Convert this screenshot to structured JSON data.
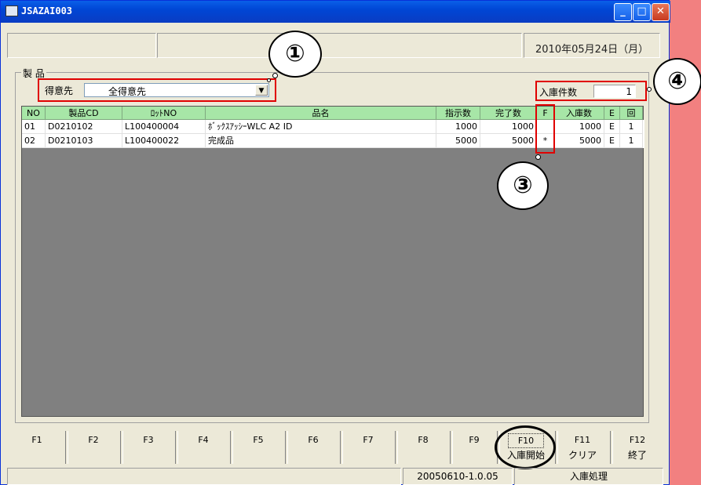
{
  "window": {
    "title": "JSAZAI003"
  },
  "header": {
    "date": "2010年05月24日（月）"
  },
  "group": {
    "title": "製 品",
    "customer_label": "得意先",
    "customer_value": "全得意先",
    "count_label": "入庫件数",
    "count_value": "1"
  },
  "table": {
    "columns": [
      "NO",
      "製品CD",
      "ﾛｯﾄNO",
      "品名",
      "指示数",
      "完了数",
      "F",
      "入庫数",
      "E",
      "回"
    ],
    "rows": [
      {
        "no": "01",
        "code": "D0210102",
        "lot": "L100400004",
        "name": "ﾎﾞｯｸｽｱｯｼｰWLC A2 ID",
        "instr": "1000",
        "done": "1000",
        "f": "",
        "recv": "1000",
        "e": "E",
        "times": "1"
      },
      {
        "no": "02",
        "code": "D0210103",
        "lot": "L100400022",
        "name": "完成品",
        "instr": "5000",
        "done": "5000",
        "f": "*",
        "recv": "5000",
        "e": "E",
        "times": "1"
      }
    ]
  },
  "fkeys": [
    {
      "key": "F1",
      "label": ""
    },
    {
      "key": "F2",
      "label": ""
    },
    {
      "key": "F3",
      "label": ""
    },
    {
      "key": "F4",
      "label": ""
    },
    {
      "key": "F5",
      "label": ""
    },
    {
      "key": "F6",
      "label": ""
    },
    {
      "key": "F7",
      "label": ""
    },
    {
      "key": "F8",
      "label": ""
    },
    {
      "key": "F9",
      "label": ""
    },
    {
      "key": "F10",
      "label": "入庫開始"
    },
    {
      "key": "F11",
      "label": "クリア"
    },
    {
      "key": "F12",
      "label": "終了"
    }
  ],
  "status": {
    "version": "20050610-1.0.05",
    "mode": "入庫処理"
  },
  "callouts": {
    "c1": "①",
    "c3": "③",
    "c4": "④"
  },
  "colors": {
    "highlight": "#e00000",
    "header_bg": "#a7e6a7",
    "page_bg": "#f28080"
  }
}
